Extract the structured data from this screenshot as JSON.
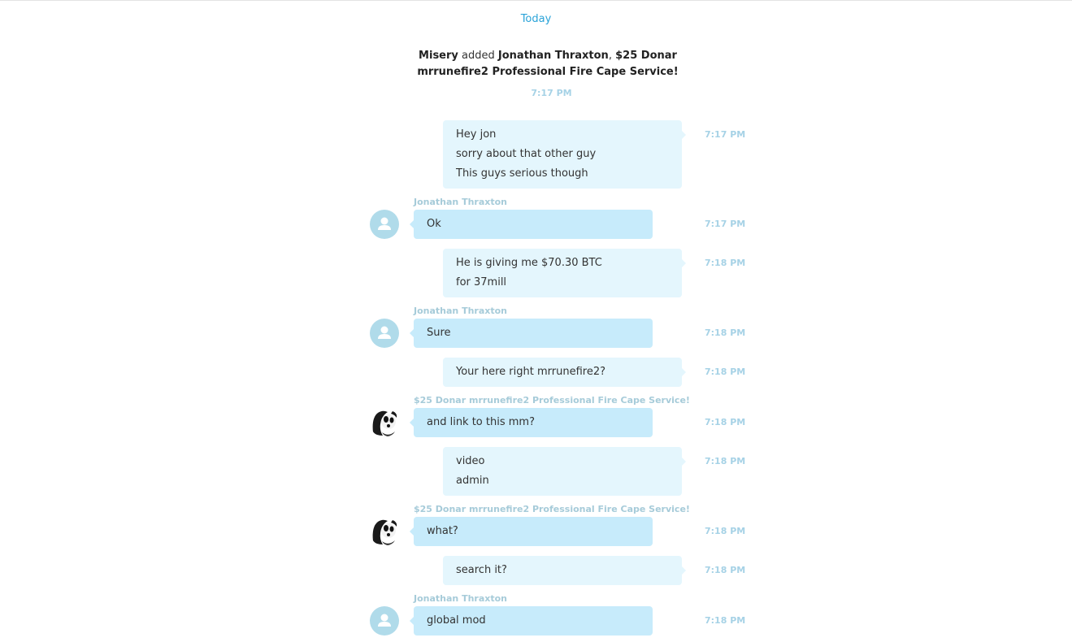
{
  "date_divider": "Today",
  "system_message": {
    "actor": "Misery",
    "verb": "added",
    "target1": "Jonathan Thraxton",
    "separator": ",",
    "target2": "$25 Donar mrrunefire2 Professional Fire Cape Service!",
    "time": "7:17 PM"
  },
  "messages": [
    {
      "dir": "out",
      "lines": [
        "Hey jon",
        "sorry about that other guy",
        "This guys serious though"
      ],
      "time": "7:17 PM"
    },
    {
      "dir": "in",
      "sender": "Jonathan Thraxton",
      "avatar": "default-user-icon",
      "lines": [
        "Ok"
      ],
      "time": "7:17 PM"
    },
    {
      "dir": "out",
      "lines": [
        "He is giving me $70.30 BTC",
        "for 37mill"
      ],
      "time": "7:18 PM"
    },
    {
      "dir": "in",
      "sender": "Jonathan Thraxton",
      "avatar": "default-user-icon",
      "lines": [
        "Sure"
      ],
      "time": "7:18 PM"
    },
    {
      "dir": "out",
      "lines": [
        "Your here right mrrunefire2?"
      ],
      "time": "7:18 PM"
    },
    {
      "dir": "in",
      "sender": "$25 Donar mrrunefire2 Professional Fire Cape Service!",
      "avatar": "panda-avatar",
      "lines": [
        "and link to this mm?"
      ],
      "time": "7:18 PM"
    },
    {
      "dir": "out",
      "lines": [
        "video",
        "admin"
      ],
      "time": "7:18 PM"
    },
    {
      "dir": "in",
      "sender": "$25 Donar mrrunefire2 Professional Fire Cape Service!",
      "avatar": "panda-avatar",
      "lines": [
        "what?"
      ],
      "time": "7:18 PM"
    },
    {
      "dir": "out",
      "lines": [
        "search it?"
      ],
      "time": "7:18 PM"
    },
    {
      "dir": "in",
      "sender": "Jonathan Thraxton",
      "avatar": "default-user-icon",
      "lines": [
        "global mod"
      ],
      "time": "7:18 PM"
    }
  ]
}
